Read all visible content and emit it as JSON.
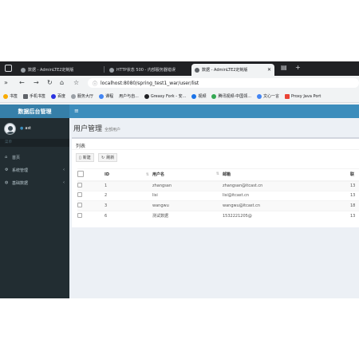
{
  "browser": {
    "tabs": [
      {
        "title": "数据 - AdminLTE2定制版",
        "active": false
      },
      {
        "title": "HTTP状态 500 - 内部服务器错误",
        "active": false
      },
      {
        "title": "数据 - AdminLTE2定制版",
        "active": true
      }
    ],
    "new_tab": "+",
    "url": "localhost:8080/spring_test1_war/user/list",
    "bookmarks": [
      {
        "label": "书签",
        "color": "#f9ab00"
      },
      {
        "label": "手机书签",
        "color": "#5f6368"
      },
      {
        "label": "百度",
        "color": "#2932e1"
      },
      {
        "label": "服务大厅",
        "color": "#9aa0a6"
      },
      {
        "label": "课程",
        "color": "#4285f4"
      },
      {
        "label": "用户与自...",
        "color": "#ea4335"
      },
      {
        "label": "Greasy Fork - 安...",
        "color": "#202124"
      },
      {
        "label": "视频",
        "color": "#1a73e8"
      },
      {
        "label": "腾讯视频-中国领...",
        "color": "#34a853"
      },
      {
        "label": "文心一言",
        "color": "#4285f4"
      },
      {
        "label": "Proxy Java Port",
        "color": "#ea4335"
      }
    ]
  },
  "sidebar": {
    "brand": "数据后台管理",
    "user": {
      "name": "ast",
      "status": "●"
    },
    "menu_header": "菜单",
    "items": [
      {
        "label": "首页",
        "icon": "home-icon",
        "has_children": false
      },
      {
        "label": "系统管理",
        "icon": "cogs-icon",
        "has_children": true
      },
      {
        "label": "基础数据",
        "icon": "globe-icon",
        "has_children": true
      }
    ]
  },
  "topbar": {
    "toggle": "≡"
  },
  "content": {
    "title": "用户管理",
    "subtitle": "全部用户",
    "box_title": "列表",
    "buttons": {
      "new": "新建",
      "refresh": "刷新"
    },
    "table": {
      "headers": [
        "",
        "ID",
        "用户名",
        "邮箱",
        "联"
      ],
      "rows": [
        {
          "id": "1",
          "username": "zhangsan",
          "email": "zhangsan@itcast.cn",
          "extra": "13"
        },
        {
          "id": "2",
          "username": "lisi",
          "email": "lisi@itcast.cn",
          "extra": "13"
        },
        {
          "id": "3",
          "username": "wangwu",
          "email": "wangwu@itcast.cn",
          "extra": "18"
        },
        {
          "id": "6",
          "username": "测试数据",
          "email": "1532221205@",
          "extra": "13"
        }
      ]
    }
  }
}
